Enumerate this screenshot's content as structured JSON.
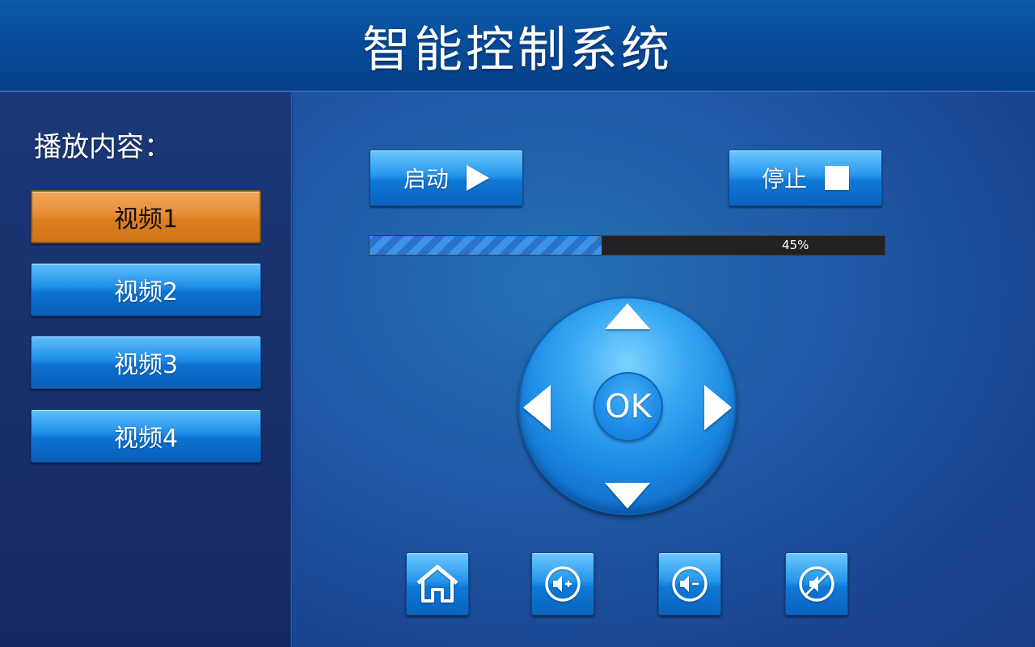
{
  "header": {
    "title": "智能控制系统"
  },
  "sidebar": {
    "label": "播放内容：",
    "items": [
      {
        "label": "视频1",
        "active": true
      },
      {
        "label": "视频2",
        "active": false
      },
      {
        "label": "视频3",
        "active": false
      },
      {
        "label": "视频4",
        "active": false
      }
    ]
  },
  "controls": {
    "start_label": "启动",
    "start_icon": "play-icon",
    "stop_label": "停止",
    "stop_icon": "stop-icon"
  },
  "progress": {
    "value_percent": 45,
    "text": "45%"
  },
  "dpad": {
    "ok_label": "OK"
  },
  "bottom_buttons": [
    {
      "icon": "home-icon"
    },
    {
      "icon": "volume-up-icon"
    },
    {
      "icon": "volume-down-icon"
    },
    {
      "icon": "mute-icon"
    }
  ],
  "colors": {
    "header_bg": "#074a98",
    "active_item": "#e88f35",
    "button_blue": "#1f8ee8",
    "progress_fill": "#3e93e8",
    "progress_track": "#222222"
  }
}
